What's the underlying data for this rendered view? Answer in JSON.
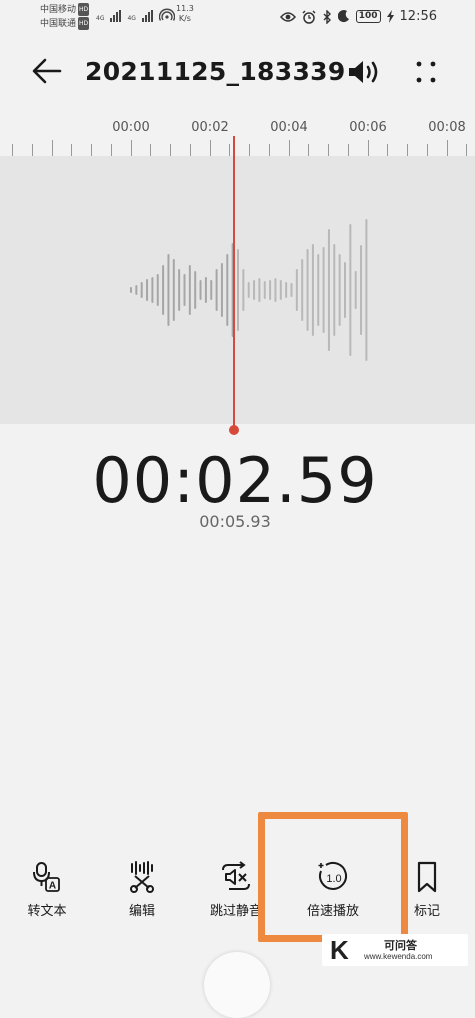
{
  "status_bar": {
    "carrier1": "中国移动",
    "carrier2": "中国联通",
    "hd": "HD",
    "net1": "4G",
    "net2": "4G",
    "speed_value": "11.3",
    "speed_unit": "K/s",
    "battery": "100",
    "time": "12:56"
  },
  "header": {
    "title": "20211125_183339"
  },
  "timeline": {
    "labels": [
      "00:00",
      "00:02",
      "00:04",
      "00:06",
      "00:08"
    ]
  },
  "playback": {
    "current_time": "00:02.59",
    "total_time": "00:05.93"
  },
  "toolbar": {
    "items": [
      {
        "label": "转文本",
        "icon": "mic-text-icon"
      },
      {
        "label": "编辑",
        "icon": "scissors-icon"
      },
      {
        "label": "跳过静音",
        "icon": "mute-skip-icon"
      },
      {
        "label": "倍速播放",
        "icon": "speed-1x-icon"
      },
      {
        "label": "标记",
        "icon": "bookmark-icon"
      }
    ]
  },
  "overlay": {
    "highlight_color": "#ee8a3f",
    "playhead_color": "#d64a3b"
  },
  "watermark": {
    "logo": "K",
    "title": "可问答",
    "url": "www.kewenda.com"
  }
}
